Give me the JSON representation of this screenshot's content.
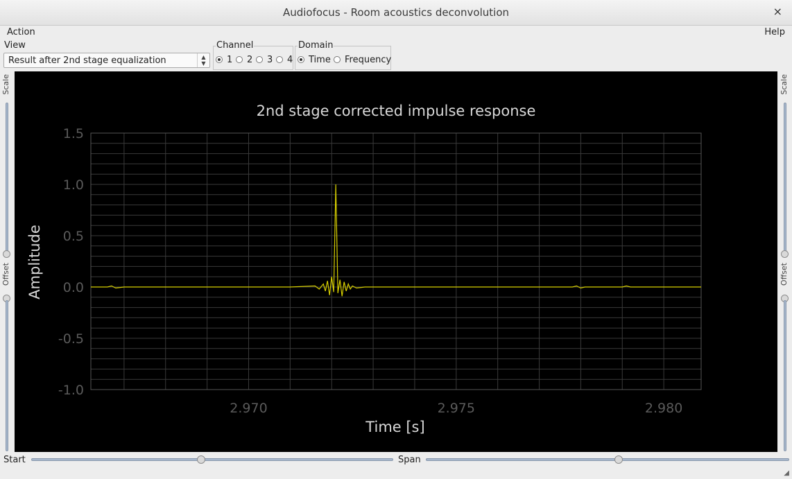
{
  "window": {
    "title": "Audiofocus - Room acoustics deconvolution",
    "close_glyph": "×"
  },
  "menu": {
    "action": "Action",
    "help": "Help"
  },
  "view": {
    "label": "View",
    "selected": "Result after 2nd stage equalization"
  },
  "channel": {
    "label": "Channel",
    "options": [
      "1",
      "2",
      "3",
      "4"
    ],
    "selected": "1"
  },
  "domain": {
    "label": "Domain",
    "options": [
      "Time",
      "Frequency"
    ],
    "selected": "Time"
  },
  "side": {
    "scale_label": "Scale",
    "offset_label": "Offset"
  },
  "bottom": {
    "start_label": "Start",
    "span_label": "Span",
    "start_position": 0.47,
    "span_position": 0.53
  },
  "colors": {
    "plot_bg": "#000000",
    "trace": "#d8d000",
    "grid": "#3a3a3a",
    "text": "#d8d8d8",
    "tick_text": "#5a5a5a"
  },
  "chart_data": {
    "type": "line",
    "title": "2nd stage corrected impulse response",
    "xlabel": "Time [s]",
    "ylabel": "Amplitude",
    "xlim": [
      2.9662,
      2.9809
    ],
    "ylim": [
      -1.0,
      1.5
    ],
    "x_ticks": [
      "2.970",
      "2.975",
      "2.980"
    ],
    "x_tick_values": [
      2.97,
      2.975,
      2.98
    ],
    "y_ticks": [
      "1.5",
      "1.0",
      "0.5",
      "0.0",
      "-0.5",
      "-1.0"
    ],
    "y_tick_values": [
      1.5,
      1.0,
      0.5,
      0.0,
      -0.5,
      -1.0
    ],
    "grid": true,
    "series": [
      {
        "color": "#d8d000",
        "x": [
          2.9662,
          2.9666,
          2.9667,
          2.9668,
          2.967,
          2.969,
          2.971,
          2.9716,
          2.9717,
          2.9718,
          2.97185,
          2.9719,
          2.97195,
          2.972,
          2.97205,
          2.9721,
          2.97215,
          2.9722,
          2.97225,
          2.9723,
          2.97235,
          2.9724,
          2.97245,
          2.9725,
          2.9726,
          2.9728,
          2.974,
          2.976,
          2.9778,
          2.9779,
          2.978,
          2.9781,
          2.979,
          2.9791,
          2.9792,
          2.98,
          2.9809
        ],
        "y": [
          0.0,
          0.0,
          0.01,
          -0.01,
          0.0,
          0.0,
          0.0,
          0.01,
          -0.02,
          0.03,
          -0.04,
          0.06,
          -0.08,
          0.1,
          -0.05,
          1.0,
          -0.06,
          0.07,
          -0.09,
          0.05,
          -0.04,
          0.03,
          -0.02,
          0.01,
          -0.01,
          0.0,
          0.0,
          0.0,
          0.0,
          0.01,
          -0.01,
          0.0,
          0.0,
          0.01,
          0.0,
          0.0,
          0.0
        ]
      }
    ]
  }
}
